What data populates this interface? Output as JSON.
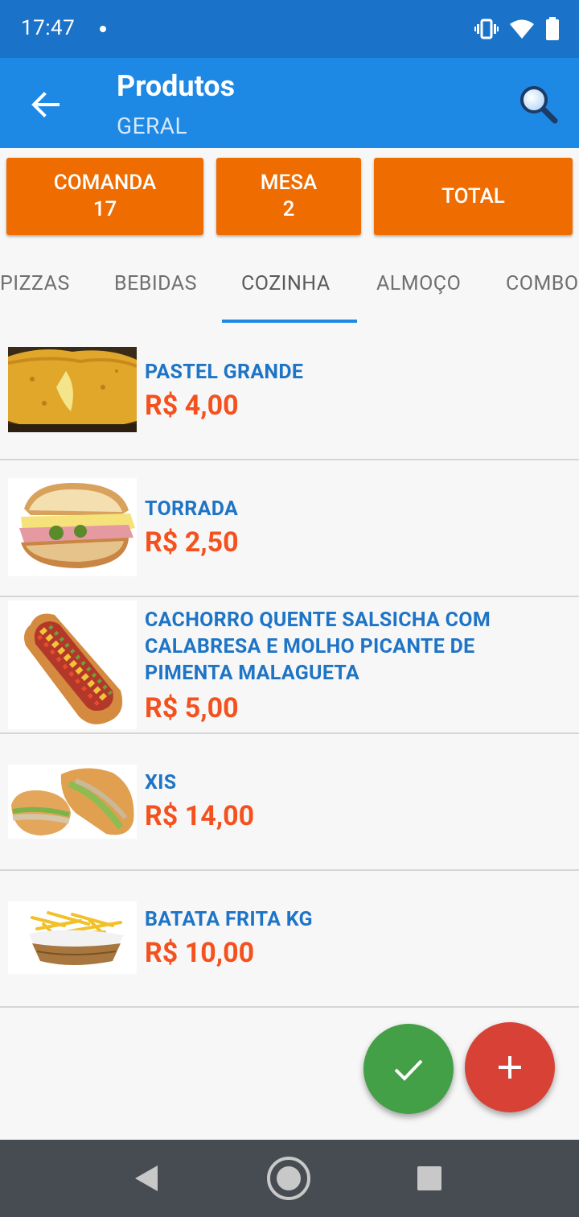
{
  "status_bar": {
    "time": "17:47"
  },
  "app_bar": {
    "title": "Produtos",
    "subtitle": "GERAL"
  },
  "summary": {
    "comanda": {
      "label": "COMANDA",
      "value": "17"
    },
    "mesa": {
      "label": "MESA",
      "value": "2"
    },
    "total": {
      "label": "TOTAL"
    }
  },
  "tabs": [
    "PIZZAS",
    "BEBIDAS",
    "COZINHA",
    "ALMOÇO",
    "COMBO"
  ],
  "active_tab": "COZINHA",
  "products": [
    {
      "name": "PASTEL GRANDE",
      "price": "R$ 4,00"
    },
    {
      "name": "TORRADA",
      "price": "R$ 2,50"
    },
    {
      "name": "CACHORRO QUENTE SALSICHA COM CALABRESA E MOLHO PICANTE DE PIMENTA MALAGUETA",
      "price": "R$ 5,00"
    },
    {
      "name": "XIS",
      "price": "R$ 14,00"
    },
    {
      "name": "BATATA FRITA KG",
      "price": "R$ 10,00"
    }
  ],
  "colors": {
    "status_bar": "#1b73c9",
    "app_bar": "#1e88e5",
    "summary_button": "#ef6c00",
    "product_name": "#1e74c6",
    "price": "#f4511e",
    "fab_confirm": "#43a047",
    "fab_add": "#d84136",
    "nav_bar": "#474c52"
  },
  "icons": {
    "back": "arrow-left-icon",
    "search": "magnifier-icon",
    "confirm": "check-icon",
    "add": "plus-icon",
    "nav_back": "triangle-back-icon",
    "nav_home": "circle-home-icon",
    "nav_recents": "square-recents-icon"
  }
}
